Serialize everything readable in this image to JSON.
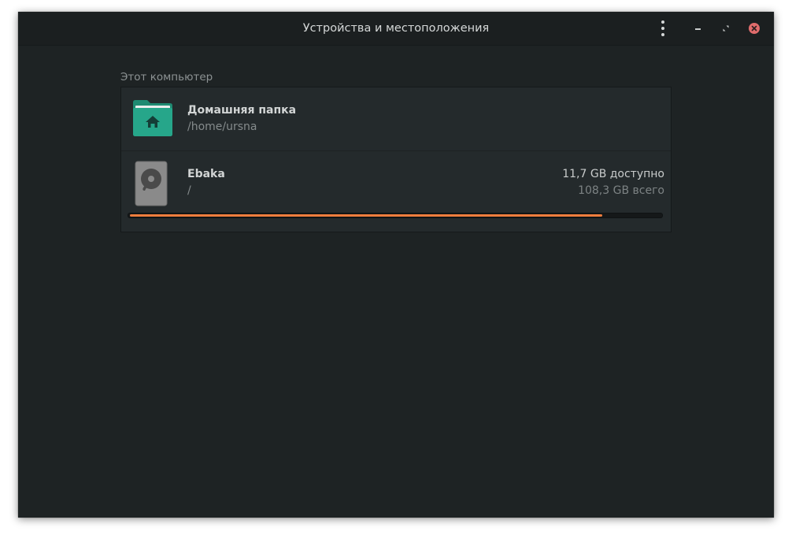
{
  "window": {
    "title": "Устройства и местоположения"
  },
  "titlebar_buttons": {
    "menu": "kebab-menu-icon",
    "minimize": "minimize-icon",
    "maximize": "maximize-icon",
    "close": "close-icon"
  },
  "section": {
    "label": "Этот компьютер"
  },
  "places": [
    {
      "icon": "home-folder-icon",
      "name": "Домашняя папка",
      "path": "/home/ursna"
    },
    {
      "icon": "hard-drive-icon",
      "name": "Ebaka",
      "path": "/",
      "free": "11,7 GB доступно",
      "total": "108,3 GB всего",
      "used_fraction": 0.89
    }
  ],
  "colors": {
    "accent_folder": "#26a68a",
    "usage_bar": "#f07d3d",
    "close_button": "#e06c6c",
    "background": "#1e2324"
  }
}
